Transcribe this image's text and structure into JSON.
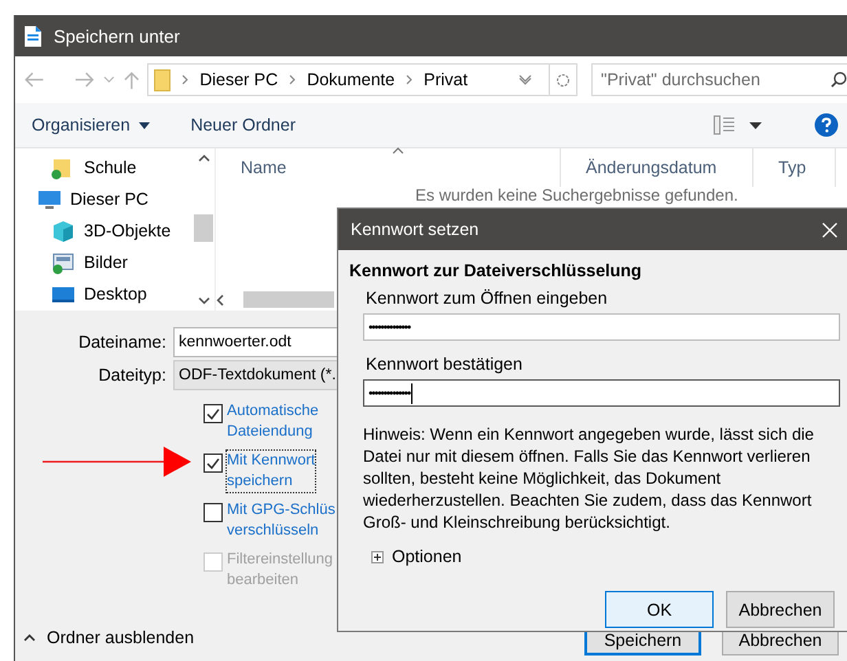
{
  "window": {
    "title": "Speichern unter"
  },
  "address": {
    "path": [
      "Dieser PC",
      "Dokumente",
      "Privat"
    ],
    "search": {
      "placeholder": "\"Privat\" durchsuchen"
    }
  },
  "toolbar": {
    "organize": "Organisieren",
    "new_folder": "Neuer Ordner"
  },
  "nav": [
    {
      "label": "Schule",
      "kind": "folder"
    },
    {
      "label": "Dieser PC",
      "kind": "pc"
    },
    {
      "label": "3D-Objekte",
      "kind": "cube"
    },
    {
      "label": "Bilder",
      "kind": "pictures"
    },
    {
      "label": "Desktop",
      "kind": "desktop"
    }
  ],
  "columns": [
    "Name",
    "Änderungsdatum",
    "Typ"
  ],
  "empty_message": "Es wurden keine Suchergebnisse gefunden.",
  "file_name": {
    "label": "Dateiname:",
    "value": "kennwoerter.odt"
  },
  "file_type": {
    "label": "Dateityp:",
    "value": "ODF-Textdokument (*."
  },
  "options": [
    {
      "lines": [
        "Automatische",
        "Dateiendung"
      ],
      "checked": true,
      "disabled": false,
      "focused": false
    },
    {
      "lines": [
        "Mit Kennwort",
        "speichern"
      ],
      "checked": true,
      "disabled": false,
      "focused": true
    },
    {
      "lines": [
        "Mit GPG-Schlüs",
        "verschlüsseln"
      ],
      "checked": false,
      "disabled": false,
      "focused": false
    },
    {
      "lines": [
        "Filtereinstellung",
        "bearbeiten"
      ],
      "checked": false,
      "disabled": true,
      "focused": false
    }
  ],
  "hide_folders": "Ordner ausblenden",
  "buttons": [
    "Speichern",
    "Abbrechen"
  ],
  "password_dialog": {
    "title": "Kennwort setzen",
    "heading": "Kennwort zur Dateiverschlüsselung",
    "fields": [
      {
        "label": "Kennwort zum Öffnen eingeben",
        "value": "••••••••••••••",
        "focused": false
      },
      {
        "label": "Kennwort bestätigen",
        "value": "••••••••••••••",
        "focused": true
      }
    ],
    "hint": "Hinweis: Wenn ein Kennwort angegeben wurde, lässt sich die Datei nur mit diesem öffnen. Falls Sie das Kennwort verlieren sollten, besteht keine Möglichkeit, das Dokument wiederherzustellen. Beachten Sie zudem, dass das Kennwort Groß- und Kleinschreibung berücksichtigt.",
    "options": "Optionen",
    "buttons": [
      "OK",
      "Abbrechen"
    ]
  }
}
